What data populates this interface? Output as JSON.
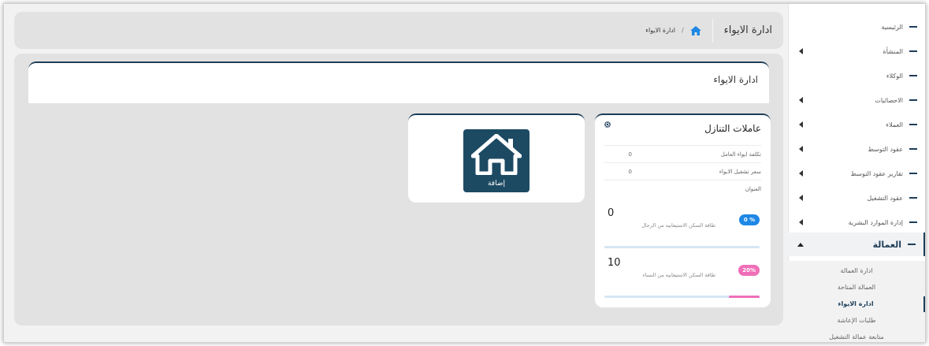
{
  "breadcrumb": {
    "title": "ادارة الايواء",
    "slash": "/",
    "current": "ادارة الايواء"
  },
  "page_header": {
    "title": "ادارة الايواء"
  },
  "sidebar": {
    "items": [
      {
        "label": "الرئيسية",
        "has_caret": false
      },
      {
        "label": "المنشأة",
        "has_caret": true
      },
      {
        "label": "الوكلاء",
        "has_caret": false
      },
      {
        "label": "الاحصائيات",
        "has_caret": true
      },
      {
        "label": "العملاء",
        "has_caret": true
      },
      {
        "label": "عقود التوسط",
        "has_caret": true
      },
      {
        "label": "تقارير عقود التوسط",
        "has_caret": true
      },
      {
        "label": "عقود التشغيل",
        "has_caret": true
      },
      {
        "label": "إدارة الموارد البشرية",
        "has_caret": true
      }
    ],
    "active": {
      "label": "العمالة"
    },
    "sub_items": [
      {
        "label": "ادارة العمالة"
      },
      {
        "label": "العمالة المتاحة"
      },
      {
        "label": "ادارة الايواء"
      },
      {
        "label": "طلبات الإعاشة"
      },
      {
        "label": "متابعة عمالة التشغيل"
      }
    ]
  },
  "stats_card": {
    "title": "عاملات التنازل",
    "rows": [
      {
        "label": "تكلفة ايواء العامل",
        "value": "0"
      },
      {
        "label": "سعر تشغيل الايواء",
        "value": "0"
      },
      {
        "label": "العنوان",
        "value": ""
      }
    ],
    "metrics": [
      {
        "number": "0",
        "label": "طاقة السكن الاستيعابيه من الرجال",
        "badge": "0 %",
        "fill": 0,
        "color": "#1e88e5",
        "bar_color": "#1e88e5"
      },
      {
        "number": "10",
        "label": "طاقة السكن الاستيعابيه من النساء",
        "badge": "20%",
        "fill": 0.2,
        "color": "#ef6fb8",
        "bar_color": "#ef6fb8"
      }
    ]
  },
  "add_card": {
    "label": "إضافة"
  },
  "colors": {
    "brand": "#1d3d58"
  }
}
